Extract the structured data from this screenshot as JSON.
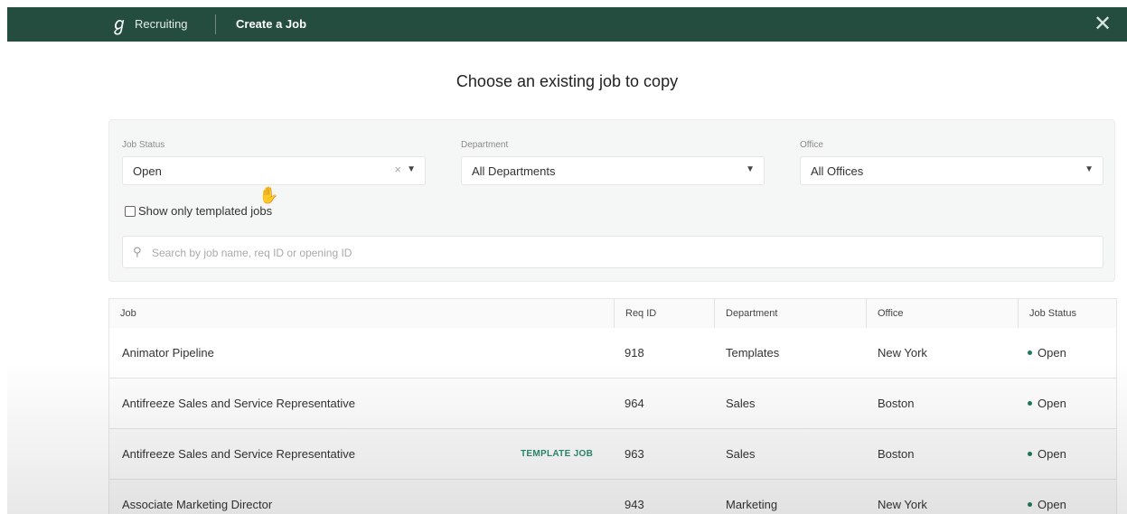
{
  "topbar": {
    "brand": "Recruiting",
    "page_name": "Create a Job"
  },
  "heading": "Choose an existing job to copy",
  "filters": {
    "job_status": {
      "label": "Job Status",
      "value": "Open"
    },
    "department": {
      "label": "Department",
      "value": "All Departments"
    },
    "office": {
      "label": "Office",
      "value": "All Offices"
    },
    "templated_checkbox": {
      "label": "Show only templated jobs",
      "checked": false
    },
    "search": {
      "placeholder": "Search by job name, req ID or opening ID",
      "value": ""
    }
  },
  "table": {
    "columns": [
      "Job",
      "Req ID",
      "Department",
      "Office",
      "Job Status"
    ],
    "rows": [
      {
        "job": "Animator Pipeline",
        "tag": "",
        "req_id": "918",
        "department": "Templates",
        "office": "New York",
        "status": "Open"
      },
      {
        "job": "Antifreeze Sales and Service Representative",
        "tag": "",
        "req_id": "964",
        "department": "Sales",
        "office": "Boston",
        "status": "Open"
      },
      {
        "job": "Antifreeze Sales and Service Representative",
        "tag": "TEMPLATE JOB",
        "req_id": "963",
        "department": "Sales",
        "office": "Boston",
        "status": "Open"
      },
      {
        "job": "Associate Marketing Director",
        "tag": "",
        "req_id": "943",
        "department": "Marketing",
        "office": "New York",
        "status": "Open"
      }
    ]
  },
  "colors": {
    "header_bg": "#244c3f",
    "status_dot": "#1f7a5c",
    "template_tag": "#2b8a6e"
  },
  "icons": {
    "logo": "greenhouse-logo-icon",
    "close": "close-icon",
    "search": "search-icon",
    "dropdown": "caret-down-icon",
    "clear": "clear-x-icon",
    "cursor": "hand-pointer-icon"
  }
}
